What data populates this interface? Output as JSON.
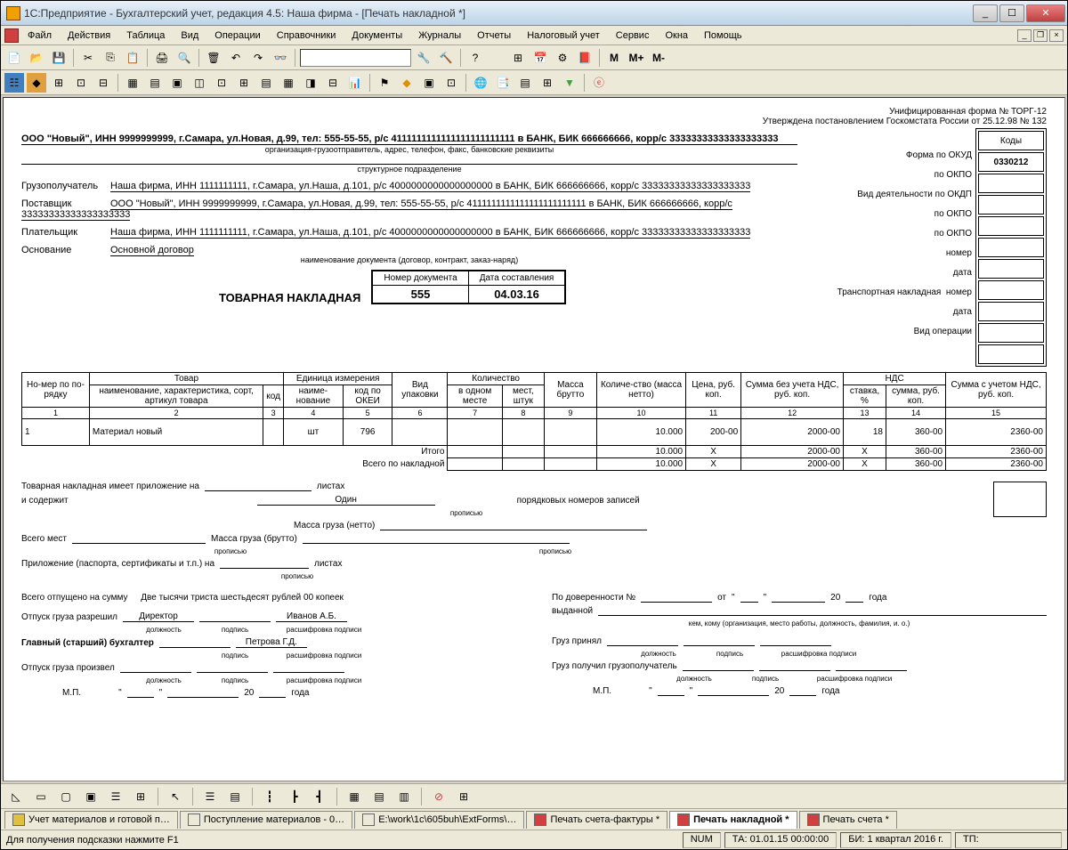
{
  "titlebar": "1С:Предприятие - Бухгалтерский учет, редакция 4.5: Наша фирма - [Печать накладной *]",
  "menu": [
    "Файл",
    "Действия",
    "Таблица",
    "Вид",
    "Операции",
    "Справочники",
    "Документы",
    "Журналы",
    "Отчеты",
    "Налоговый учет",
    "Сервис",
    "Окна",
    "Помощь"
  ],
  "form": {
    "top1": "Унифицированная форма № ТОРГ-12",
    "top2": "Утверждена постановлением Госкомстата России от 25.12.98 № 132",
    "codes_header": "Коды",
    "okud": "0330212",
    "code_labels": [
      "Форма по ОКУД",
      "по ОКПО",
      "Вид деятельности по ОКДП",
      "по ОКПО",
      "по ОКПО",
      "номер",
      "дата",
      "номер",
      "дата",
      "Вид операции"
    ],
    "trans_label": "Транспортная накладная",
    "sender": "ООО \"Новый\", ИНН 9999999999, г.Самара, ул.Новая, д.99, тел: 555-55-55, р/с 4111111111111111111111111 в БАНК, БИК 666666666, корр/с 33333333333333333333",
    "sender_cap": "организация-грузоотправитель, адрес, телефон, факс, банковские реквизиты",
    "struct_cap": "структурное подразделение",
    "recipient_label": "Грузополучатель",
    "recipient": "Наша фирма, ИНН 1111111111, г.Самара, ул.Наша, д.101, р/с 4000000000000000000 в БАНК, БИК 666666666, корр/с 33333333333333333333",
    "supplier_label": "Поставщик",
    "supplier": "ООО \"Новый\", ИНН 9999999999, г.Самара, ул.Новая, д.99, тел: 555-55-55, р/с 4111111111111111111111111 в БАНК, БИК 666666666, корр/с 33333333333333333333",
    "payer_label": "Плательщик",
    "payer": "Наша фирма, ИНН 1111111111, г.Самара, ул.Наша, д.101, р/с 4000000000000000000 в БАНК, БИК 666666666, корр/с 33333333333333333333",
    "basis_label": "Основание",
    "basis": "Основной договор",
    "basis_cap": "наименование документа (договор, контракт, заказ-наряд)",
    "doc_title": "ТОВАРНАЯ НАКЛАДНАЯ",
    "num_label": "Номер документа",
    "date_label": "Дата составления",
    "doc_number": "555",
    "doc_date": "04.03.16"
  },
  "table": {
    "headers": {
      "nomer": "Но-мер по по-рядку",
      "tovar": "Товар",
      "name": "наименование, характеристика, сорт, артикул товара",
      "kod": "код",
      "ed": "Единица измерения",
      "ed_name": "наиме-нование",
      "ed_okei": "код по ОКЕИ",
      "vid": "Вид упаковки",
      "qty": "Количество",
      "qty_place": "в одном месте",
      "qty_mest": "мест, штук",
      "mass_brutto": "Масса брутто",
      "qty_netto": "Количе-ство (масса нетто)",
      "price": "Цена, руб. коп.",
      "sum_no_vat": "Сумма без учета НДС, руб. коп.",
      "vat": "НДС",
      "vat_rate": "ставка, %",
      "vat_sum": "сумма, руб. коп.",
      "sum_with_vat": "Сумма с учетом НДС, руб. коп."
    },
    "nums": [
      "1",
      "2",
      "3",
      "4",
      "5",
      "6",
      "7",
      "8",
      "9",
      "10",
      "11",
      "12",
      "13",
      "14",
      "15"
    ],
    "rows": [
      {
        "n": "1",
        "name": "Материал новый",
        "kod": "",
        "ed": "шт",
        "okei": "796",
        "vid": "",
        "q1": "",
        "q2": "",
        "brutto": "",
        "netto": "10.000",
        "price": "200-00",
        "sum": "2000-00",
        "rate": "18",
        "vatsum": "360-00",
        "total": "2360-00"
      }
    ],
    "itogo_label": "Итого",
    "vsego_label": "Всего по накладной",
    "totals": {
      "netto": "10.000",
      "price": "X",
      "sum": "2000-00",
      "rate": "X",
      "vatsum": "360-00",
      "total": "2360-00"
    }
  },
  "footer": {
    "attach": "Товарная накладная имеет приложение на",
    "sheets": "листах",
    "contains": "и содержит",
    "one": "Один",
    "propis": "прописью",
    "records": "порядковых номеров записей",
    "total_mest": "Всего мест",
    "mass_netto": "Масса груза (нетто)",
    "mass_brutto": "Масса груза (брутто)",
    "prilozh": "Приложение (паспорта, сертификаты и т.п.) на",
    "sum_words_label": "Всего отпущено на сумму",
    "sum_words": "Две тысячи триста шестьдесят рублей 00 копеек",
    "release_allowed": "Отпуск груза разрешил",
    "director": "Директор",
    "director_name": "Иванов А.Б.",
    "chief_acc": "Главный (старший) бухгалтер",
    "acc_name": "Петрова Г.Д.",
    "release_done": "Отпуск груза произвел",
    "dolzhnost": "должность",
    "podpis": "подпись",
    "rasshifr": "расшифровка подписи",
    "mp": "М.П.",
    "goda": "года",
    "twenty": "20",
    "dover": "По доверенности №",
    "ot": "от",
    "issued": "выданной",
    "kem": "кем, кому (организация, место работы, должность, фамилия, и. о.)",
    "received": "Груз принял",
    "got": "Груз получил грузополучатель"
  },
  "tabs": [
    {
      "label": "Учет материалов и готовой п…",
      "icon": "book"
    },
    {
      "label": "Поступление материалов - 0…",
      "icon": "doc"
    },
    {
      "label": "E:\\work\\1c\\605buh\\ExtForms\\…",
      "icon": "doc"
    },
    {
      "label": "Печать счета-фактуры *",
      "icon": "print"
    },
    {
      "label": "Печать накладной *",
      "icon": "print",
      "active": true
    },
    {
      "label": "Печать счета *",
      "icon": "print"
    }
  ],
  "statusbar": {
    "hint": "Для получения подсказки нажмите F1",
    "num": "NUM",
    "ta": "ТА: 01.01.15 00:00:00",
    "bi": "БИ: 1 квартал 2016 г.",
    "tp": "ТП:"
  }
}
